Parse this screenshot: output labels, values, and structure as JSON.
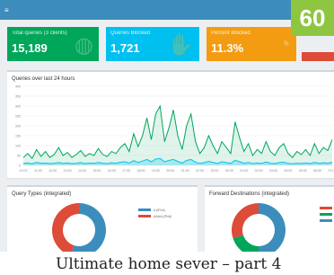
{
  "page_number": "60",
  "header": {
    "menu_icon": "menu-icon"
  },
  "cards": [
    {
      "label": "Total queries (3 clients)",
      "value": "15,189",
      "color": "#00a65a",
      "icon": "globe-icon"
    },
    {
      "label": "Queries Blocked",
      "value": "1,721",
      "color": "#00c0ef",
      "icon": "hand-icon"
    },
    {
      "label": "Percent Blocked",
      "value": "11.3%",
      "color": "#f39c12",
      "icon": "pie-icon"
    }
  ],
  "queries_chart": {
    "title": "Queries over last 24 hours"
  },
  "chart_data": {
    "type": "area",
    "title": "Queries over last 24 hours",
    "xlabel": "",
    "ylabel": "",
    "ylim": [
      0,
      400
    ],
    "y_ticks": [
      0,
      50,
      100,
      150,
      200,
      250,
      300,
      350,
      400
    ],
    "x_ticks": [
      "10:00",
      "11:00",
      "12:00",
      "13:00",
      "14:00",
      "15:00",
      "16:00",
      "17:00",
      "18:00",
      "19:00",
      "20:00",
      "21:00",
      "22:00",
      "23:00",
      "00:00",
      "01:00",
      "02:00",
      "03:00",
      "04:00",
      "05:00",
      "06:00",
      "07:00"
    ],
    "series": [
      {
        "color": "#00a65a",
        "values": [
          40,
          60,
          35,
          80,
          45,
          70,
          40,
          55,
          90,
          50,
          65,
          40,
          55,
          75,
          45,
          60,
          50,
          85,
          55,
          45,
          70,
          60,
          90,
          110,
          70,
          160,
          95,
          150,
          240,
          130,
          260,
          300,
          120,
          190,
          280,
          150,
          80,
          200,
          260,
          120,
          60,
          90,
          150,
          100,
          60,
          120,
          90,
          60,
          220,
          140,
          70,
          110,
          50,
          80,
          60,
          120,
          70,
          50,
          90,
          110,
          60,
          40,
          70,
          55,
          80,
          50,
          110,
          60,
          90,
          75,
          130
        ]
      },
      {
        "color": "#00c0ef",
        "values": [
          10,
          12,
          8,
          15,
          10,
          12,
          9,
          11,
          14,
          10,
          12,
          9,
          10,
          14,
          9,
          12,
          10,
          15,
          11,
          9,
          13,
          11,
          16,
          18,
          12,
          24,
          15,
          22,
          30,
          18,
          32,
          35,
          18,
          25,
          30,
          20,
          12,
          25,
          30,
          16,
          10,
          14,
          20,
          15,
          10,
          18,
          14,
          10,
          26,
          18,
          11,
          15,
          9,
          12,
          10,
          17,
          11,
          9,
          14,
          16,
          10,
          8,
          11,
          9,
          12,
          9,
          15,
          10,
          13,
          11,
          16
        ]
      }
    ]
  },
  "query_types": {
    "title": "Query Types (integrated)",
    "legend": [
      {
        "label": "A (IPv4)",
        "color": "#3c8dbc"
      },
      {
        "label": "AAAA (IPv6)",
        "color": "#dd4b39"
      }
    ],
    "slices": [
      {
        "value": 55,
        "color": "#3c8dbc"
      },
      {
        "value": 45,
        "color": "#dd4b39"
      }
    ]
  },
  "forward_destinations": {
    "title": "Forward Destinations (integrated)",
    "legend": [
      {
        "color": "#dd4b39"
      },
      {
        "color": "#00a65a"
      },
      {
        "color": "#3c8dbc"
      }
    ],
    "slices": [
      {
        "value": 50,
        "color": "#3c8dbc"
      },
      {
        "value": 20,
        "color": "#00a65a"
      },
      {
        "value": 30,
        "color": "#dd4b39"
      }
    ]
  },
  "caption": "Ultimate home sever – part 4"
}
